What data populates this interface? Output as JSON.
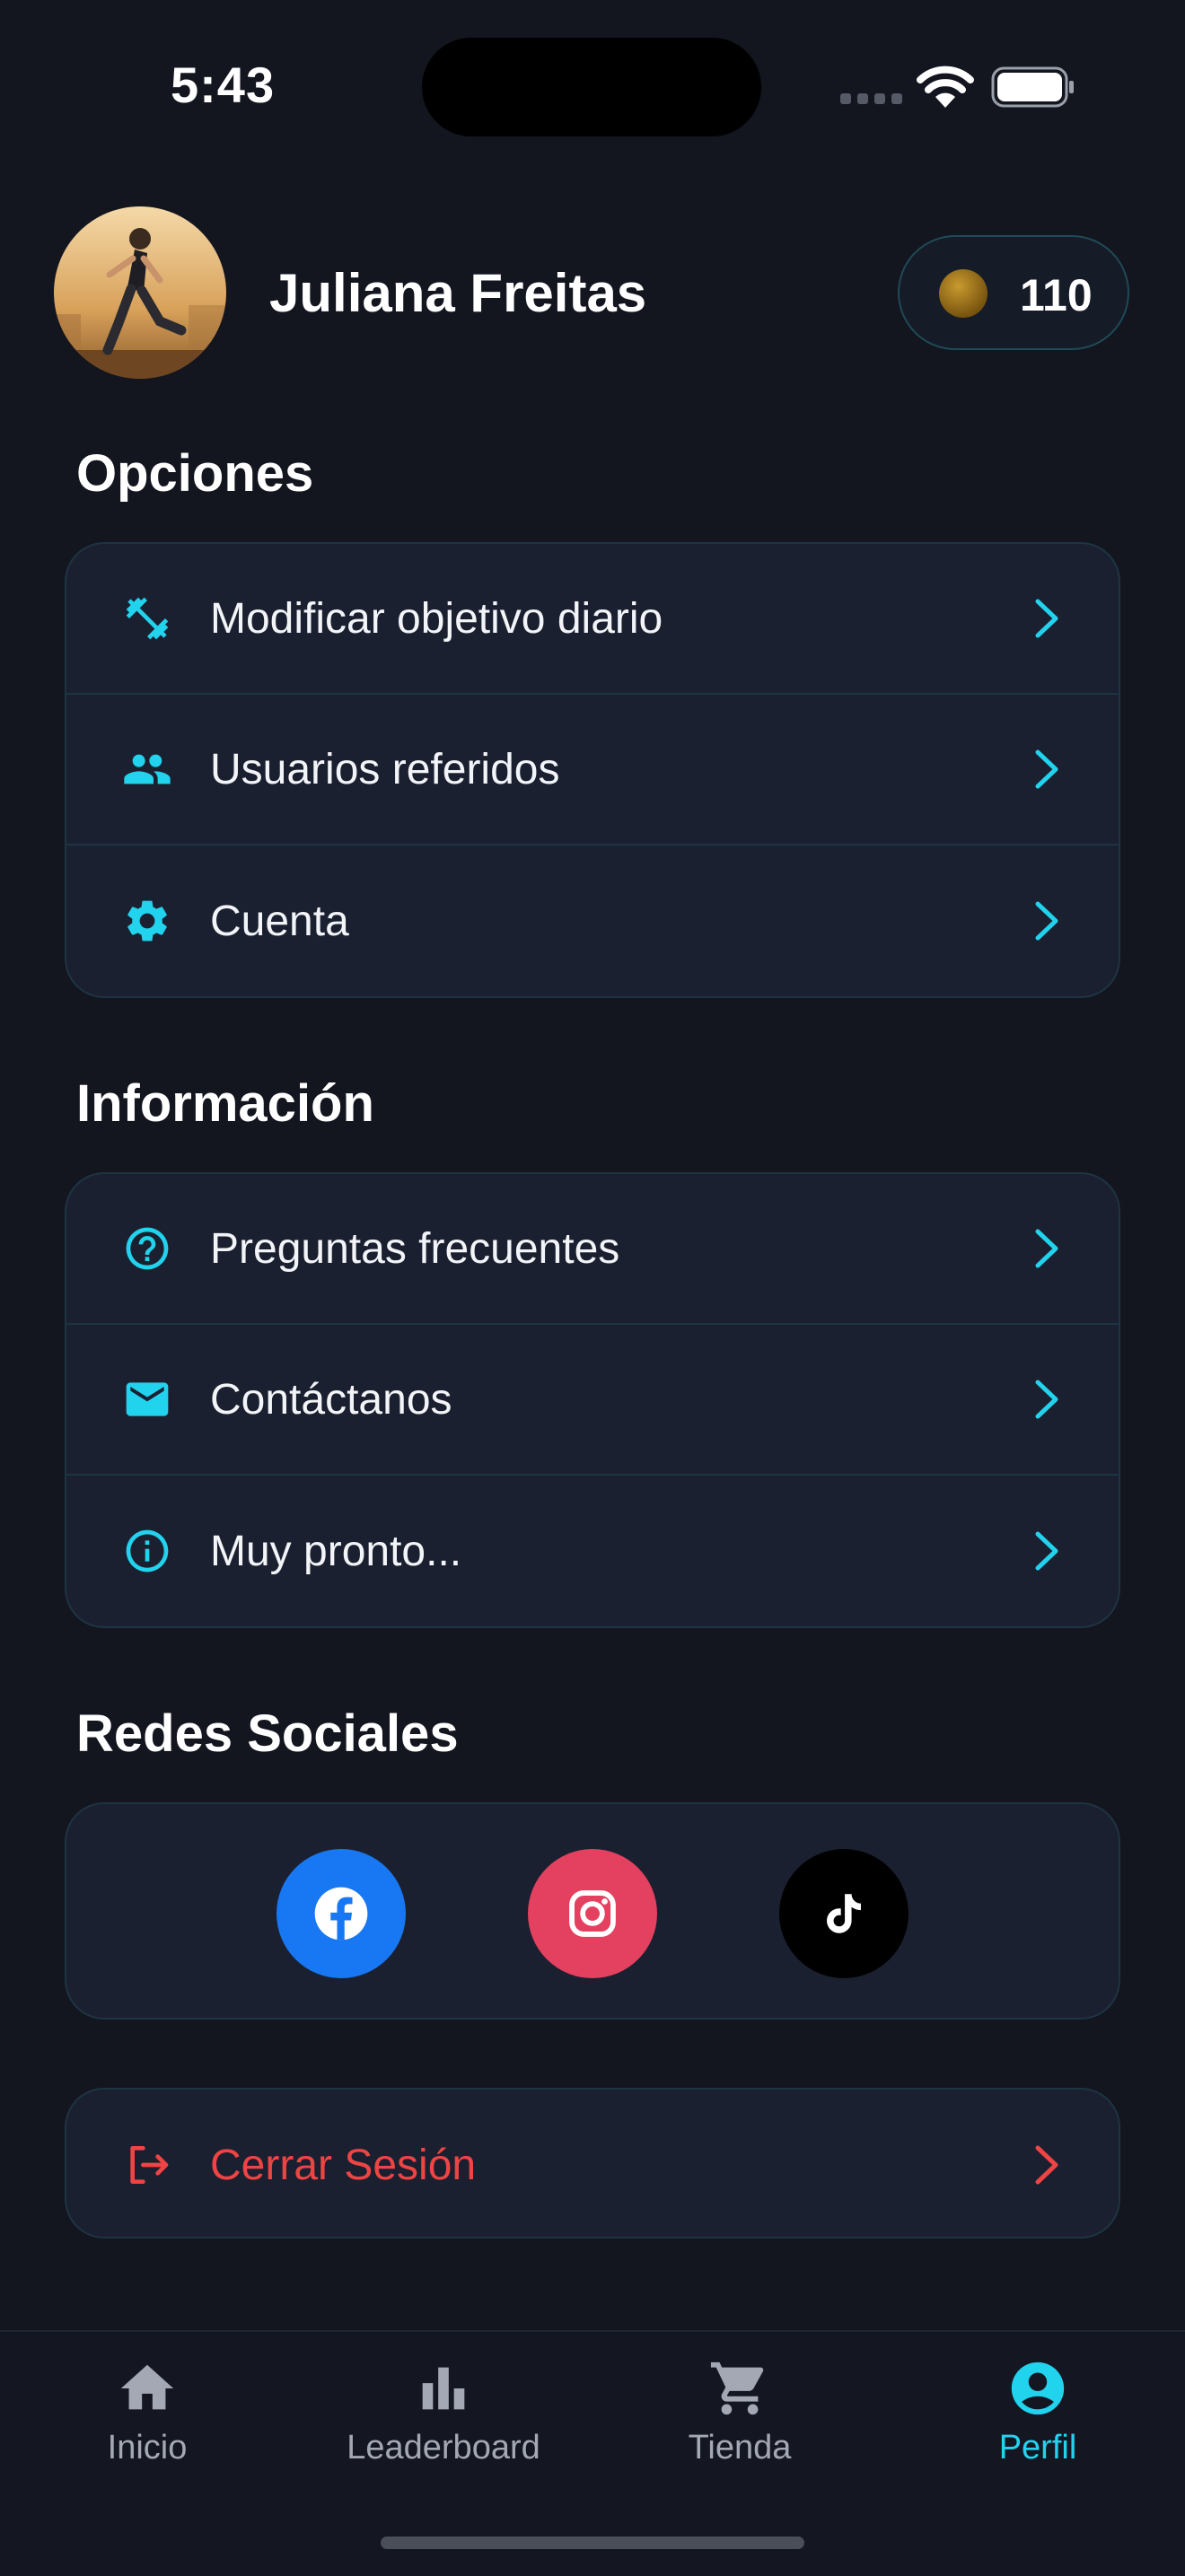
{
  "status_bar": {
    "time": "5:43"
  },
  "header": {
    "user_name": "Juliana Freitas",
    "coins": "110"
  },
  "options": {
    "title": "Opciones",
    "items": [
      {
        "label": "Modificar objetivo diario",
        "icon": "dumbbell-icon"
      },
      {
        "label": "Usuarios referidos",
        "icon": "people-icon"
      },
      {
        "label": "Cuenta",
        "icon": "gear-icon"
      }
    ]
  },
  "info": {
    "title": "Información",
    "items": [
      {
        "label": "Preguntas frecuentes",
        "icon": "help-circle-icon"
      },
      {
        "label": "Contáctanos",
        "icon": "mail-icon"
      },
      {
        "label": "Muy pronto...",
        "icon": "info-icon"
      }
    ]
  },
  "social": {
    "title": "Redes Sociales",
    "networks": [
      {
        "name": "facebook",
        "color": "#1877f2"
      },
      {
        "name": "instagram",
        "color": "#e4405f"
      },
      {
        "name": "tiktok",
        "color": "#000000"
      }
    ]
  },
  "logout": {
    "label": "Cerrar Sesión",
    "color": "#ef4444"
  },
  "nav": {
    "items": [
      {
        "label": "Inicio",
        "icon": "home-icon"
      },
      {
        "label": "Leaderboard",
        "icon": "bar-chart-icon"
      },
      {
        "label": "Tienda",
        "icon": "cart-icon"
      },
      {
        "label": "Perfil",
        "icon": "user-circle-icon",
        "active": true
      }
    ]
  },
  "colors": {
    "accent": "#22d3ee",
    "background": "#13151f",
    "card": "#1b2030"
  }
}
